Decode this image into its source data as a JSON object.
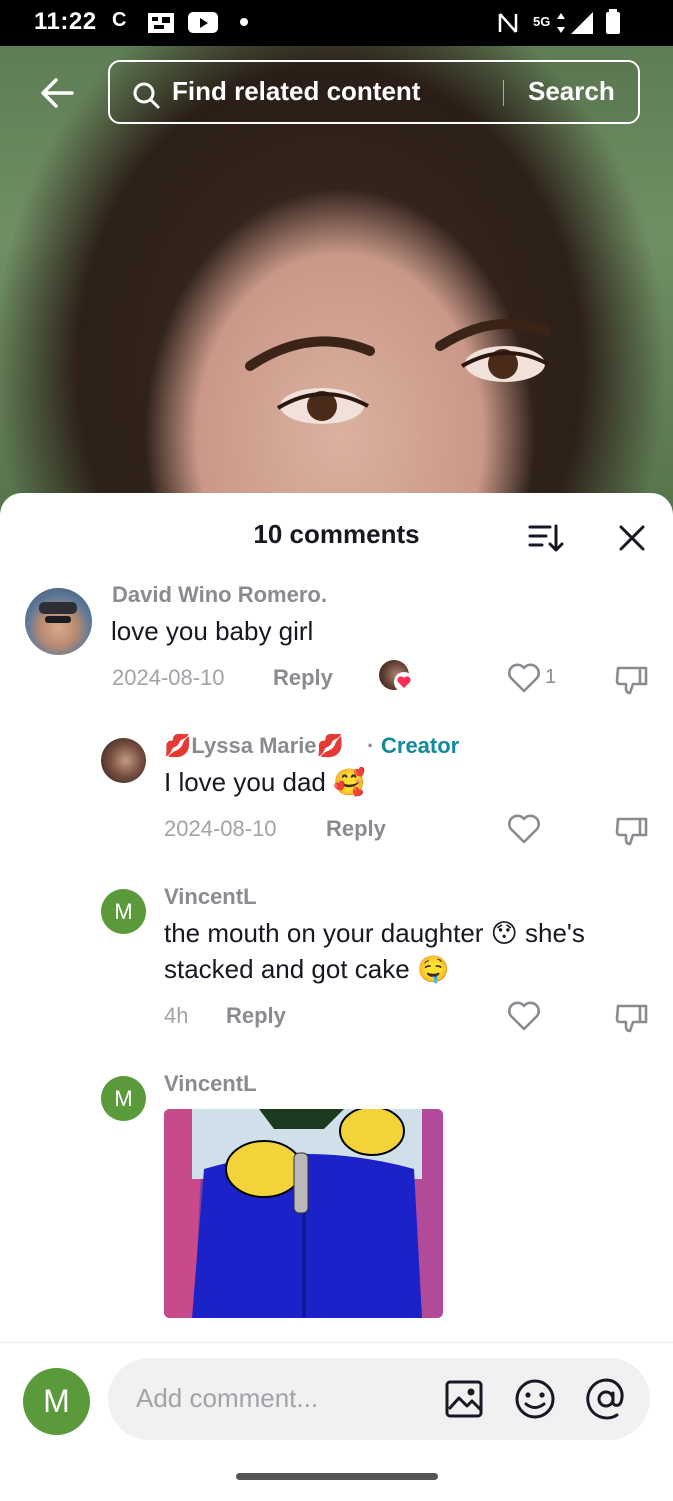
{
  "status_bar": {
    "time": "11:22",
    "carrier_letter": "C",
    "network": "5G"
  },
  "top": {
    "search_placeholder": "Find related content",
    "search_button": "Search"
  },
  "comments_sheet": {
    "title": "10 comments",
    "comments": [
      {
        "author": "David Wino Romero.",
        "text": "love you baby girl",
        "date": "2024-08-10",
        "reply_label": "Reply",
        "likes": "1"
      },
      {
        "author": "💋Lyssa Marie💋",
        "separator": "·",
        "badge": "Creator",
        "text": "I love you dad 🥰",
        "date": "2024-08-10",
        "reply_label": "Reply"
      },
      {
        "author": "VincentL",
        "text_line1": "the mouth on your daughter 😯 she's",
        "text_line2": "stacked and got cake 🤤",
        "date": "4h",
        "reply_label": "Reply",
        "avatar_letter": "M"
      },
      {
        "author": "VincentL",
        "avatar_letter": "M"
      }
    ]
  },
  "composer": {
    "avatar_letter": "M",
    "placeholder": "Add comment..."
  }
}
